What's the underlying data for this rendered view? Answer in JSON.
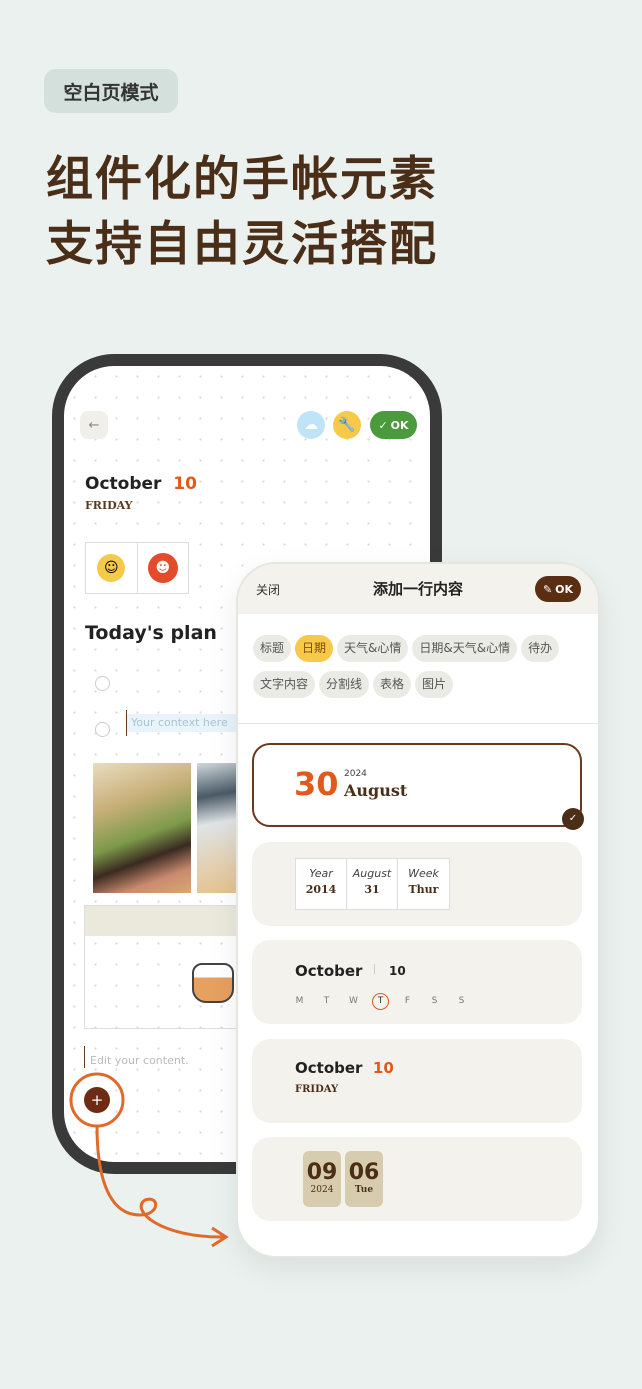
{
  "badge": "空白页模式",
  "headline": [
    "组件化的手帐元素",
    "支持自由灵活搭配"
  ],
  "colors": {
    "background": "#eaf1ef",
    "headline": "#4a2e17",
    "accent_orange": "#e05a1e",
    "ok_green": "#4b9a3d",
    "brown": "#5a2e12",
    "chip_selected": "#f7c948"
  },
  "journal": {
    "back_icon": "arrow-left-icon",
    "weather_icon": "cloud-face-icon",
    "tools_icon": "wrench-icon",
    "ok_label": "OK",
    "month": "October",
    "day": "10",
    "weekday": "FRIDAY",
    "plan_title": "Today's plan",
    "todo_placeholder": "Your context here",
    "text_placeholder": "Edit your content.",
    "add_icon": "plus-icon"
  },
  "panel": {
    "close": "关闭",
    "title": "添加一行内容",
    "ok": "OK",
    "chips": [
      {
        "label": "标题"
      },
      {
        "label": "日期",
        "selected": true
      },
      {
        "label": "天气&心情"
      },
      {
        "label": "日期&天气&心情"
      },
      {
        "label": "待办"
      },
      {
        "label": "文字内容"
      },
      {
        "label": "分割线"
      },
      {
        "label": "表格"
      },
      {
        "label": "图片"
      }
    ],
    "styles": {
      "s1": {
        "day": "30",
        "year": "2024",
        "month": "August",
        "selected": true
      },
      "s2": {
        "cols": [
          {
            "h": "Year",
            "v": "2014"
          },
          {
            "h": "August",
            "v": "31"
          },
          {
            "h": "Week",
            "v": "Thur"
          }
        ]
      },
      "s3": {
        "month": "October",
        "day": "10",
        "weekdays": [
          "M",
          "T",
          "W",
          "T",
          "F",
          "S",
          "S"
        ],
        "highlighted_index": 3
      },
      "s4": {
        "month": "October",
        "day": "10",
        "weekday": "FRIDAY"
      },
      "s5": {
        "month": "09",
        "year": "2024",
        "day": "06",
        "weekday": "Tue"
      }
    }
  }
}
